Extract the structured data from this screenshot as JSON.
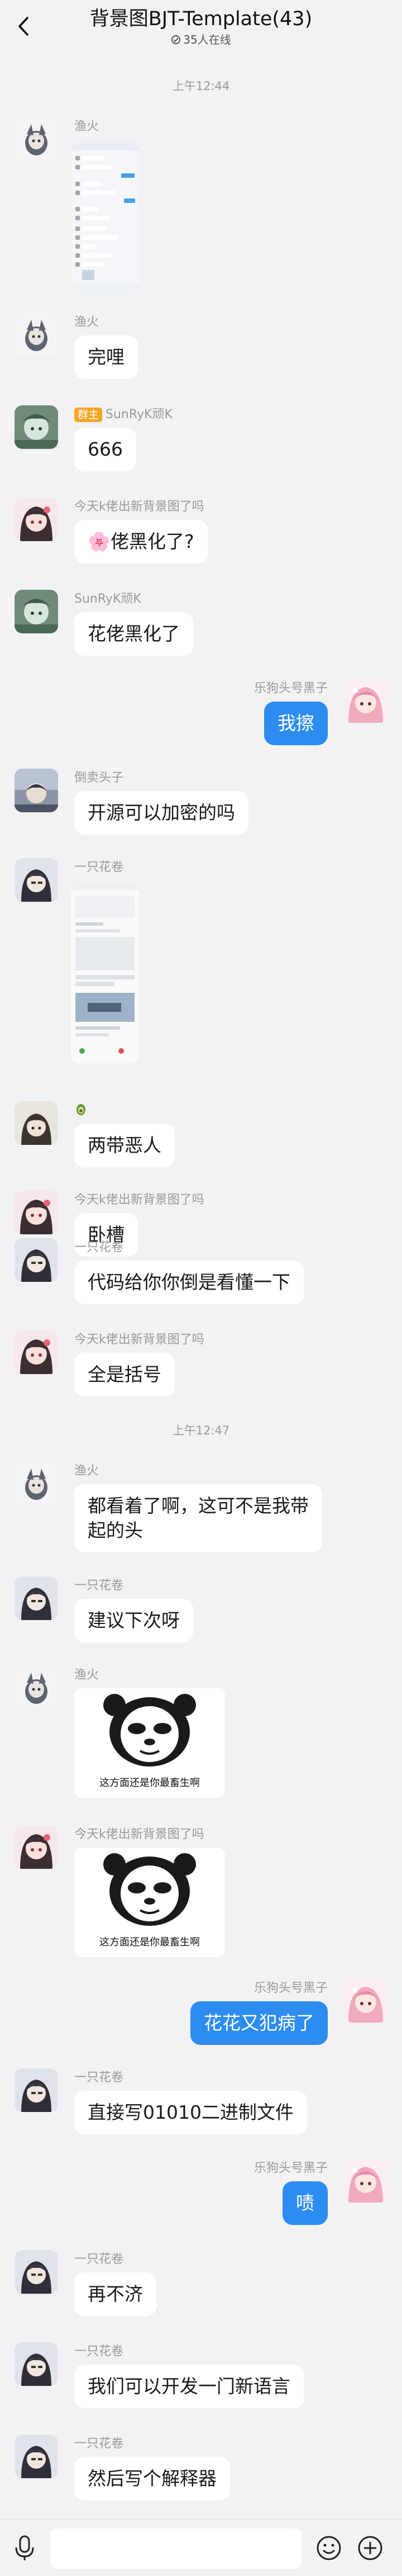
{
  "header": {
    "title": "背景图BJT-Template(43)",
    "online": "35人在线"
  },
  "times": [
    "上午12:44",
    "上午12:47"
  ],
  "messages": [
    {
      "name": "渔火"
    },
    {
      "name": "渔火",
      "text": "完哩"
    },
    {
      "tag": "群主",
      "name": "SunRyK顽K",
      "text": "666"
    },
    {
      "name": "今天k佬出新背景图了吗",
      "emoji": "🌸",
      "text": "佬黑化了?"
    },
    {
      "name": "SunRyK顽K",
      "text": "花佬黑化了"
    },
    {
      "name": "乐狗头号黑子",
      "text": "我擦"
    },
    {
      "name": "倒卖头子",
      "text": "开源可以加密的吗"
    },
    {
      "name": "一只花卷"
    },
    {
      "name": "",
      "text": "两带恶人"
    },
    {
      "name": "今天k佬出新背景图了吗",
      "text": "卧槽"
    },
    {
      "name": "一只花卷",
      "text": "代码给你你倒是看懂一下"
    },
    {
      "name": "今天k佬出新背景图了吗",
      "text": "全是括号"
    },
    {
      "name": "渔火",
      "text_line1": "都看着了啊，这可不是我带",
      "text_line2": "起的头"
    },
    {
      "name": "一只花卷",
      "text": "建议下次呀"
    },
    {
      "name": "渔火",
      "caption": "这方面还是你最畜生啊"
    },
    {
      "name": "今天k佬出新背景图了吗",
      "caption": "这方面还是你最畜生啊"
    },
    {
      "name": "乐狗头号黑子",
      "text": "花花又犯病了"
    },
    {
      "name": "一只花卷",
      "text": "直接写01010二进制文件"
    },
    {
      "name": "乐狗头号黑子",
      "text": "啧"
    },
    {
      "name": "一只花卷",
      "text": "再不济"
    },
    {
      "name": "一只花卷",
      "text": "我们可以开发一门新语言"
    },
    {
      "name": "一只花卷",
      "text": "然后写个解释器"
    }
  ],
  "colors": {
    "background": "#f2f2f4",
    "bubble_left": "#ffffff",
    "bubble_right": "#2d8cf0",
    "owner_tag": "#f5a623"
  },
  "icons": [
    "back-arrow-icon",
    "online-status-icon",
    "voice-icon",
    "emoji-icon",
    "plus-icon"
  ]
}
